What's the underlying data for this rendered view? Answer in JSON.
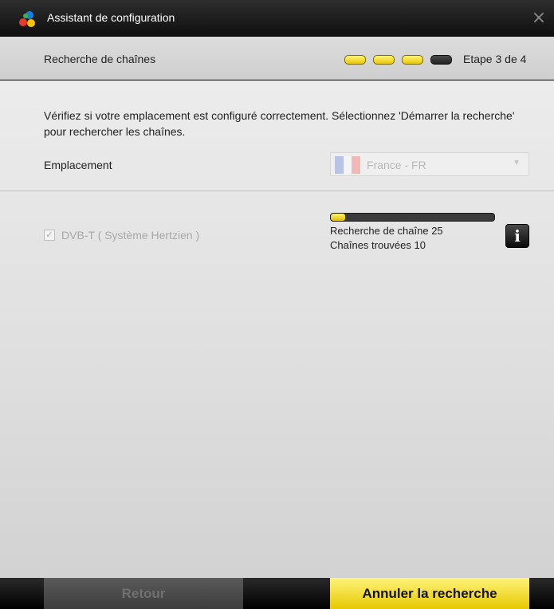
{
  "window": {
    "title": "Assistant de configuration",
    "logo_icon": "app-logo-icon",
    "close_icon": "close-icon",
    "close_glyph": "×"
  },
  "header": {
    "title": "Recherche de chaînes",
    "step_indicator": [
      "done",
      "done",
      "done",
      "todo"
    ],
    "step_label": "Etape 3 de 4"
  },
  "main": {
    "intro": "Vérifiez si votre emplacement est configuré correctement. Sélectionnez 'Démarrer la recherche' pour rechercher les chaînes.",
    "location": {
      "label": "Emplacement",
      "value": "France - FR",
      "flag_icon": "france-flag-icon",
      "disabled": true
    }
  },
  "scan": {
    "dvb_label": "DVB-T ( Système Hertzien )",
    "dvb_checked": true,
    "progress_fraction": 0.09,
    "search_text": "Recherche de chaîne 25",
    "found_text": "Chaînes trouvées 10",
    "info_glyph": "i"
  },
  "footer": {
    "back_label": "Retour",
    "cancel_label": "Annuler la recherche"
  },
  "colors": {
    "accent": "#f5dc2b",
    "dark": "#111111",
    "panel": "#e6e6e6"
  }
}
